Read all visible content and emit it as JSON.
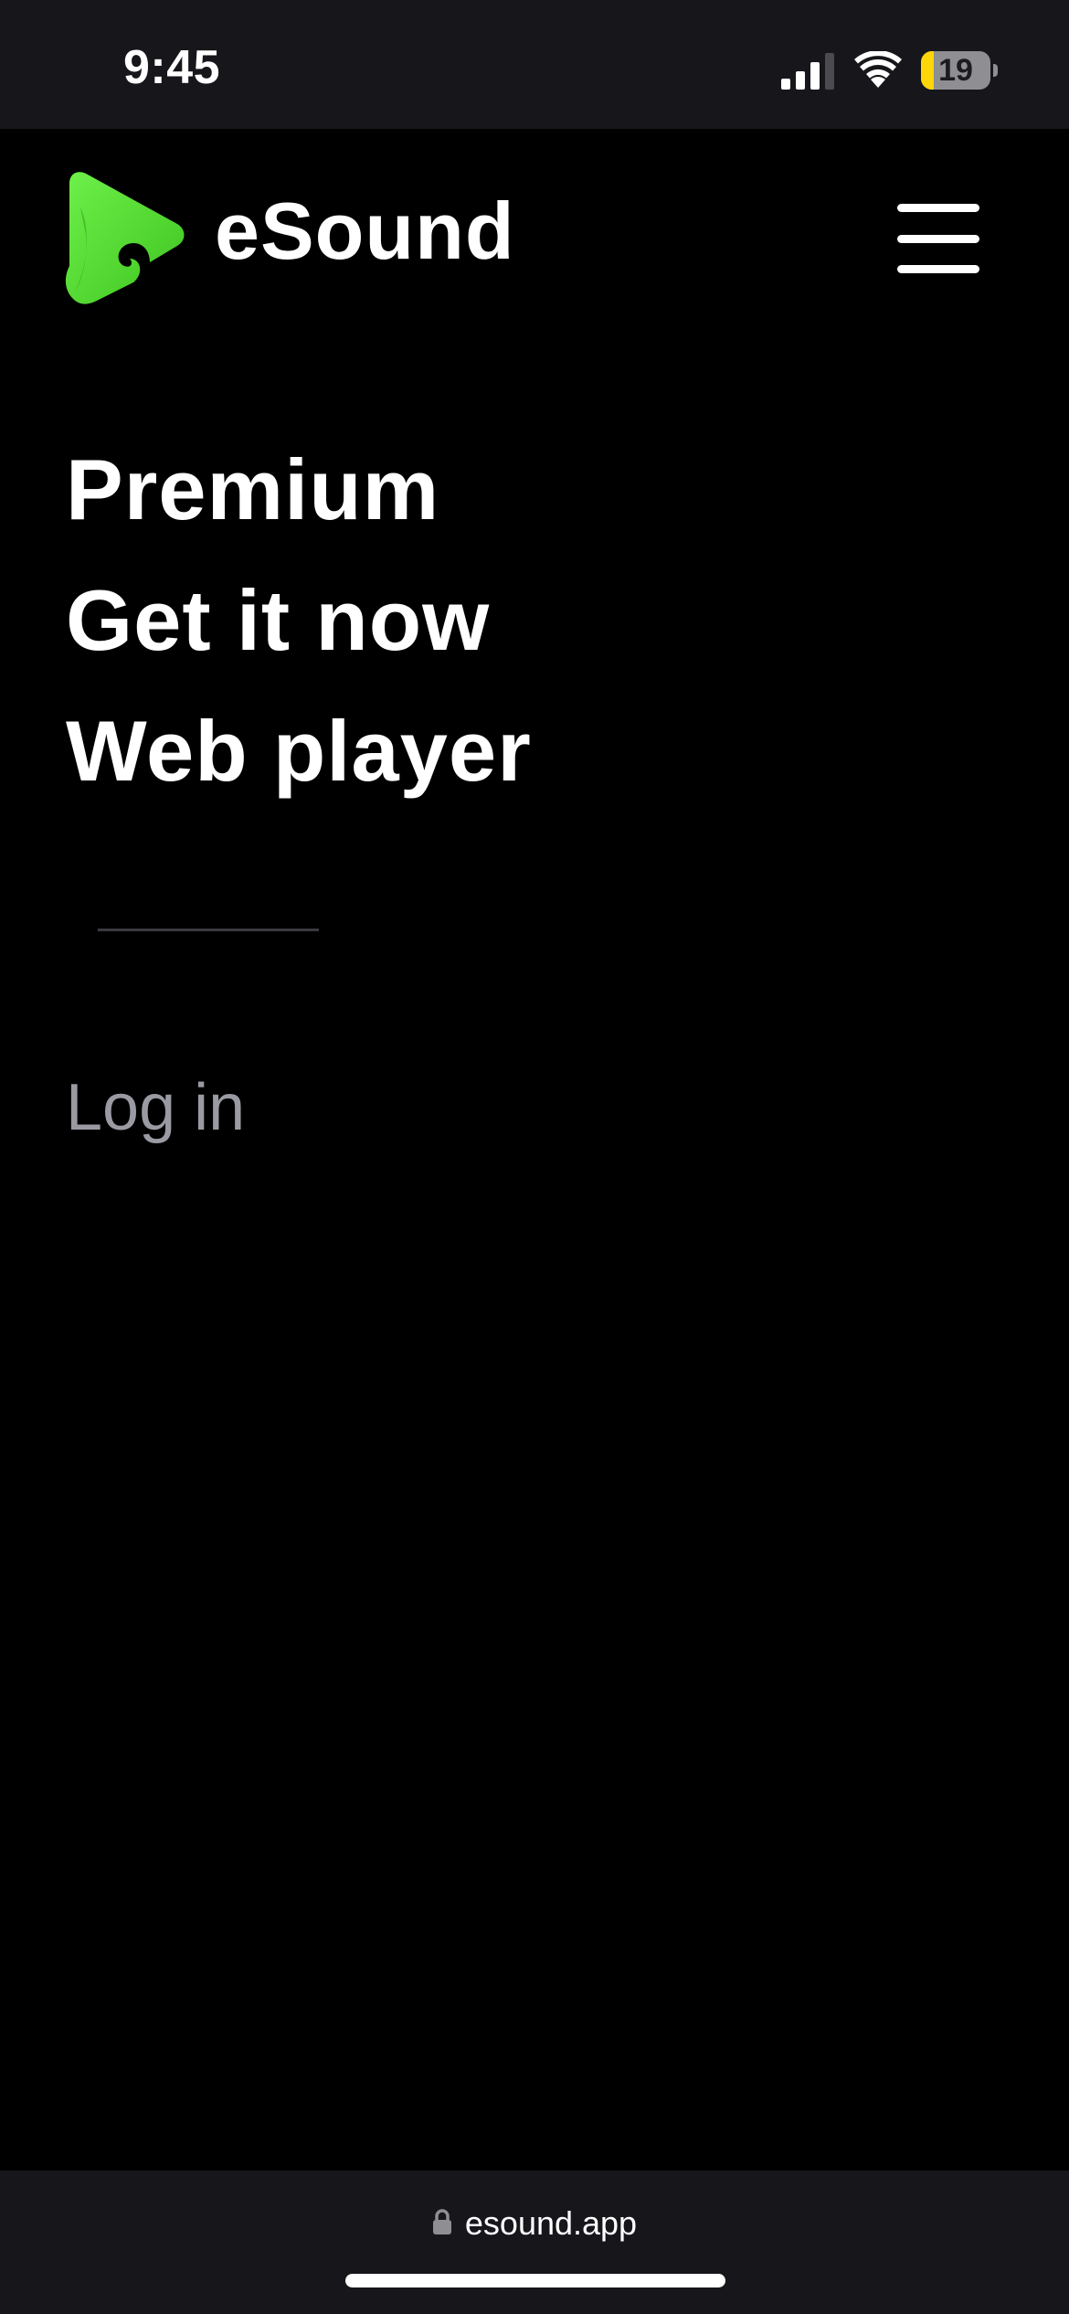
{
  "status_bar": {
    "time": "9:45",
    "battery_level": "19",
    "battery_fraction": 0.19,
    "battery_color": "#ffd60a"
  },
  "header": {
    "brand_name": "eSound",
    "logo_icon": "esound-logo-icon",
    "menu_icon": "hamburger-menu-icon",
    "brand_color": "#5ee03a"
  },
  "nav": {
    "items": [
      {
        "label": "Premium"
      },
      {
        "label": "Get it now"
      },
      {
        "label": "Web player"
      }
    ],
    "login_label": "Log in"
  },
  "browser": {
    "url": "esound.app",
    "lock_icon": "lock-icon"
  }
}
